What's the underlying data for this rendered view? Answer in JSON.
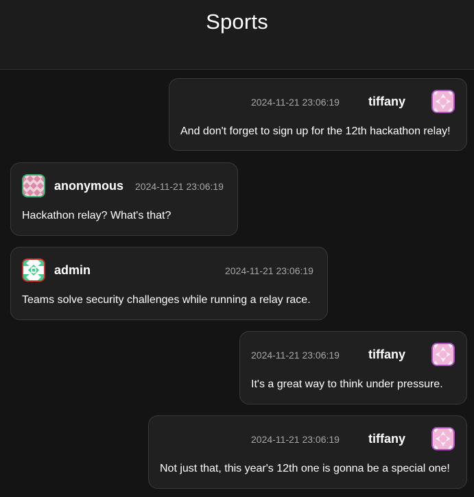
{
  "header": {
    "title": "Sports"
  },
  "messages": [
    {
      "user": "tiffany",
      "time": "2024-11-21 23:06:19",
      "text": "And don't forget to sign up for the 12th hackathon relay!",
      "avatar_color": "#b04fc4",
      "side": "right"
    },
    {
      "user": "anonymous",
      "time": "2024-11-21 23:06:19",
      "text": "Hackathon relay? What's that?",
      "avatar_color": "#2fae6a",
      "side": "left"
    },
    {
      "user": "admin",
      "time": "2024-11-21 23:06:19",
      "text": "Teams solve security challenges while running a relay race.",
      "avatar_color": "#d42b2b",
      "side": "left"
    },
    {
      "user": "tiffany",
      "time": "2024-11-21 23:06:19",
      "text": "It's a great way to think under pressure.",
      "avatar_color": "#b04fc4",
      "side": "right"
    },
    {
      "user": "tiffany",
      "time": "2024-11-21 23:06:19",
      "text": "Not just that, this year's 12th one is gonna be a special one!",
      "avatar_color": "#b04fc4",
      "side": "right"
    }
  ]
}
